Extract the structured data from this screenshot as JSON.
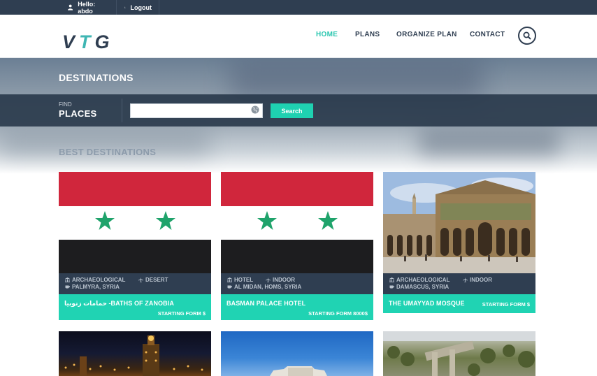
{
  "topbar": {
    "hello": "Hello: abdo",
    "logout": "Logout"
  },
  "header": {
    "logo_v": "V",
    "logo_t": "T",
    "logo_g": "G",
    "nav": [
      "HOME",
      "PLANS",
      "ORGANIZE PLAN",
      "CONTACT"
    ],
    "active": "HOME"
  },
  "banner": {
    "title": "DESTINATIONS",
    "find": "FIND",
    "places": "PLACES",
    "search_value": "",
    "search_button": "Search"
  },
  "section_title": "BEST DESTINATIONS",
  "cards": [
    {
      "tag1": "ARCHAEOLOGICAL",
      "tag2": "DESERT",
      "location": "PALMYRA, SYRIA",
      "name": "حمامات زنوبيا -BATHS OF ZANOBIA",
      "price": "STARTING FORM $",
      "image": "syrian-flag"
    },
    {
      "tag1": "HOTEL",
      "tag2": "INDOOR",
      "location": "AL MIDAN, HOMS, SYRIA",
      "name": "BASMAN PALACE HOTEL",
      "price": "STARTING FORM 8000$",
      "image": "syrian-flag"
    },
    {
      "tag1": "ARCHAEOLOGICAL",
      "tag2": "INDOOR",
      "location": "DAMASCUS, SYRIA",
      "name": "THE UMAYYAD MOSQUE",
      "price": "STARTING FORM $",
      "image": "umayyad-mosque-photo"
    }
  ],
  "colors": {
    "dark": "#2f3e51",
    "accent": "#20d3b3",
    "flag_red": "#d0263c",
    "flag_green": "#1fa36b"
  }
}
